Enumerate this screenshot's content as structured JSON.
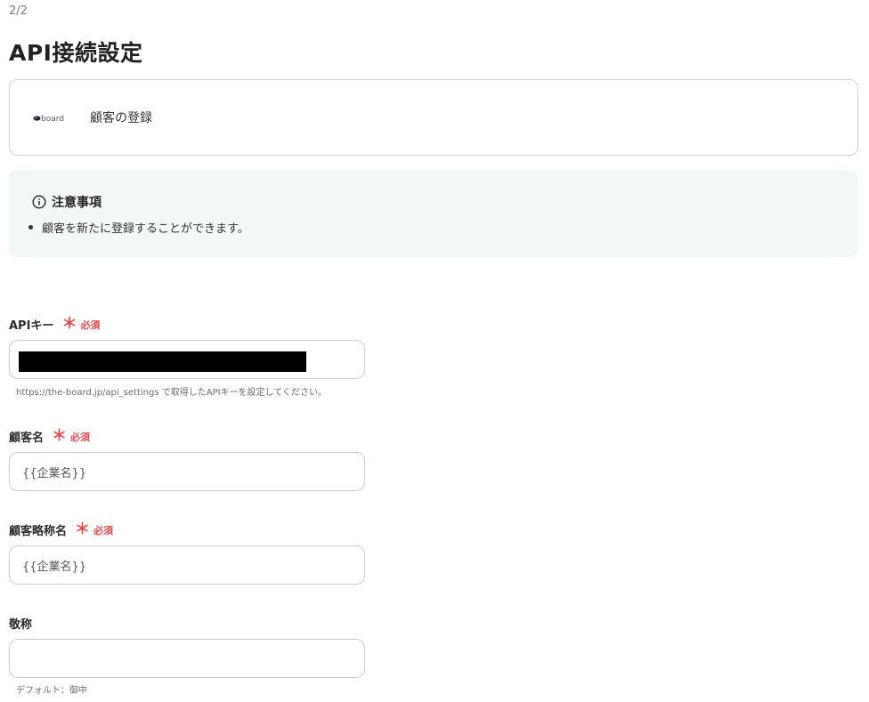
{
  "header": {
    "step": "2/2",
    "title": "API接続設定"
  },
  "app": {
    "logo_text": "board",
    "action_label": "顧客の登録"
  },
  "notice": {
    "title": "注意事項",
    "items": [
      "顧客を新たに登録することができます。"
    ]
  },
  "form": {
    "required_label": "必須",
    "required_mark": "＊",
    "fields": [
      {
        "label": "APIキー",
        "value": "",
        "hint": "https://the-board.jp/api_settings で取得したAPIキーを設定してください。"
      },
      {
        "label": "顧客名",
        "value": "{{企業名}}"
      },
      {
        "label": "顧客略称名",
        "value": "{{企業名}}"
      },
      {
        "label": "敬称",
        "value": "",
        "hint": "デフォルト：御中"
      }
    ]
  }
}
